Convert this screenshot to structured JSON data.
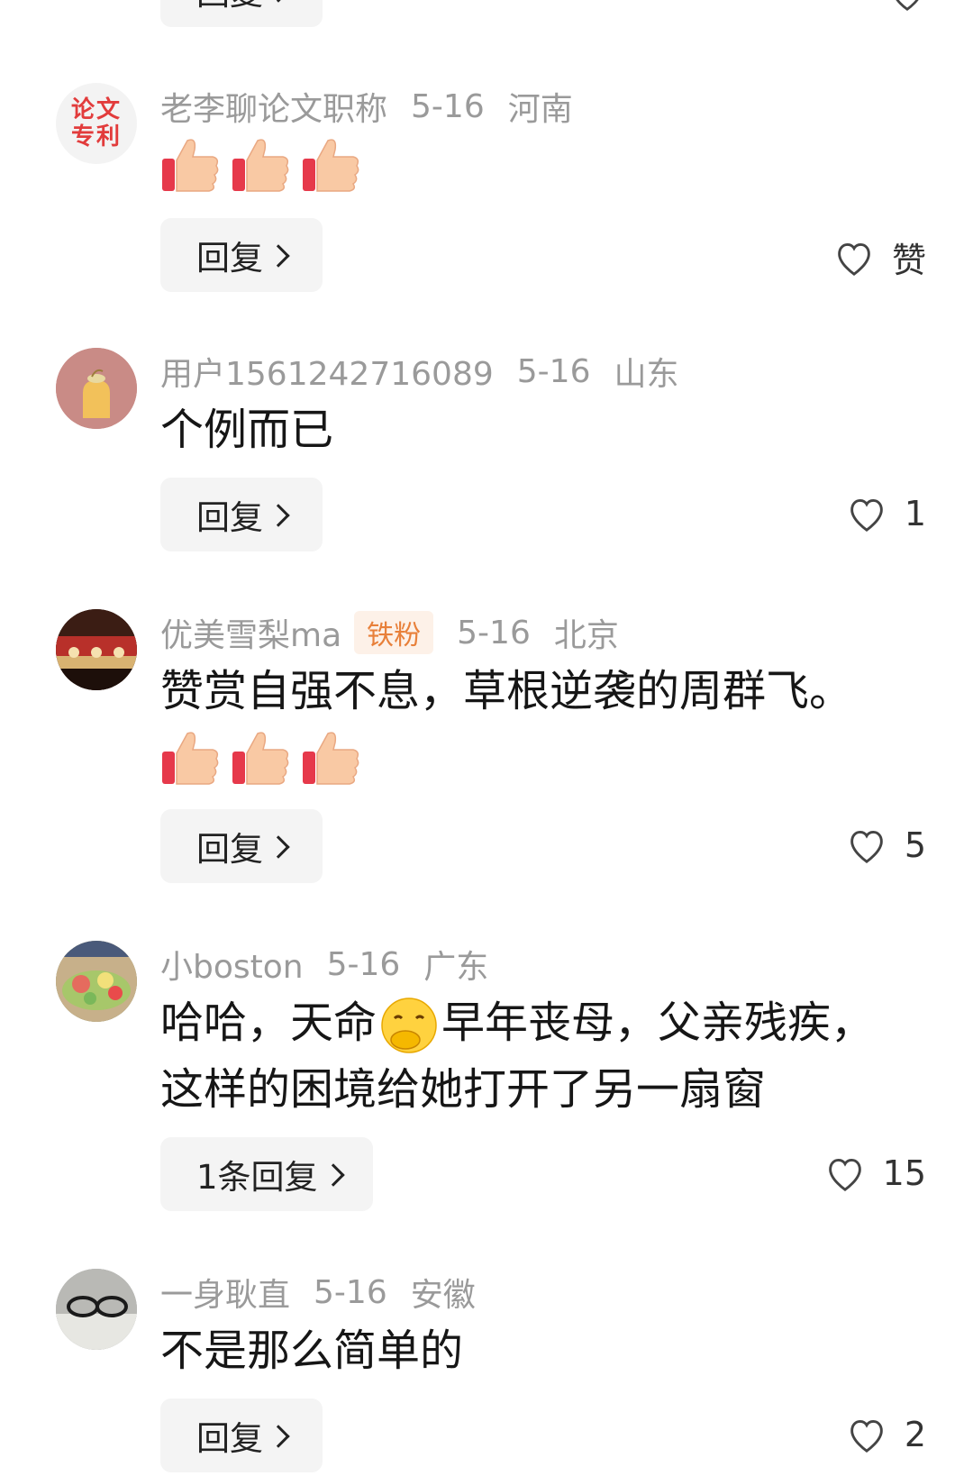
{
  "top_partial": {
    "reply_label": "回复"
  },
  "comments": [
    {
      "author": "老李聊论文职称",
      "date": "5-16",
      "location": "河南",
      "avatar_text_line1": "论文",
      "avatar_text_line2": "专利",
      "emoji": [
        "thumbs-up-emoji",
        "thumbs-up-emoji",
        "thumbs-up-emoji"
      ],
      "reply_label": "回复",
      "like_label": "赞"
    },
    {
      "author": "用户1561242716089",
      "date": "5-16",
      "location": "山东",
      "text": "个例而已",
      "reply_label": "回复",
      "likes": "1"
    },
    {
      "author": "优美雪梨ma",
      "badge": "铁粉",
      "date": "5-16",
      "location": "北京",
      "text": "赞赏自强不息，草根逆袭的周群飞。",
      "emoji": [
        "thumbs-up-emoji",
        "thumbs-up-emoji",
        "thumbs-up-emoji"
      ],
      "reply_label": "回复",
      "likes": "5"
    },
    {
      "author": "小boston",
      "date": "5-16",
      "location": "广东",
      "text_line1_a": "哈哈，天命",
      "text_line1_b": "早年丧母，父亲残疾，",
      "text_line2": "这样的困境给她打开了另一扇窗",
      "inline_emoji": "giggle-emoji",
      "reply_label": "1条回复",
      "likes": "15"
    },
    {
      "author": "一身耿直",
      "date": "5-16",
      "location": "安徽",
      "text": "不是那么简单的",
      "reply_label": "回复",
      "likes": "2"
    }
  ],
  "colors": {
    "meta_gray": "#9a9a9a",
    "reply_bg": "#f4f4f4",
    "badge_orange": "#e8803a",
    "avatar_red": "#e23c3c"
  }
}
